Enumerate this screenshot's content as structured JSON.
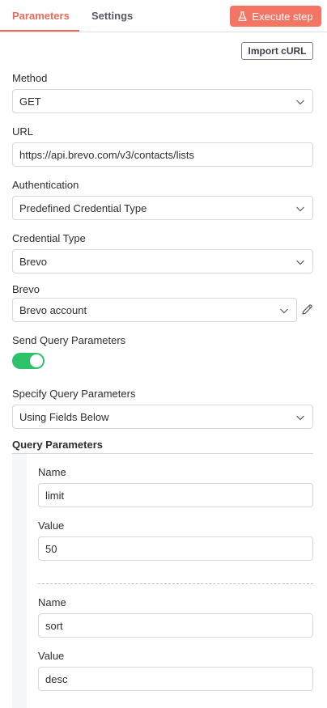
{
  "tabs": {
    "parameters": "Parameters",
    "settings": "Settings"
  },
  "execute_button": "Execute step",
  "import_button": "Import cURL",
  "method": {
    "label": "Method",
    "value": "GET"
  },
  "url": {
    "label": "URL",
    "value": "https://api.brevo.com/v3/contacts/lists"
  },
  "authentication": {
    "label": "Authentication",
    "value": "Predefined Credential Type"
  },
  "credential_type": {
    "label": "Credential Type",
    "value": "Brevo"
  },
  "brevo": {
    "label": "Brevo",
    "value": "Brevo account"
  },
  "send_query": {
    "label": "Send Query Parameters",
    "enabled": true
  },
  "specify_query": {
    "label": "Specify Query Parameters",
    "value": "Using Fields Below"
  },
  "query_parameters": {
    "title": "Query Parameters",
    "items": [
      {
        "name_label": "Name",
        "name": "limit",
        "value_label": "Value",
        "value": "50"
      },
      {
        "name_label": "Name",
        "name": "sort",
        "value_label": "Value",
        "value": "desc"
      }
    ]
  },
  "colors": {
    "accent": "#ea6b5a",
    "execute_bg": "#f47563",
    "toggle_on": "#2ec26b"
  }
}
